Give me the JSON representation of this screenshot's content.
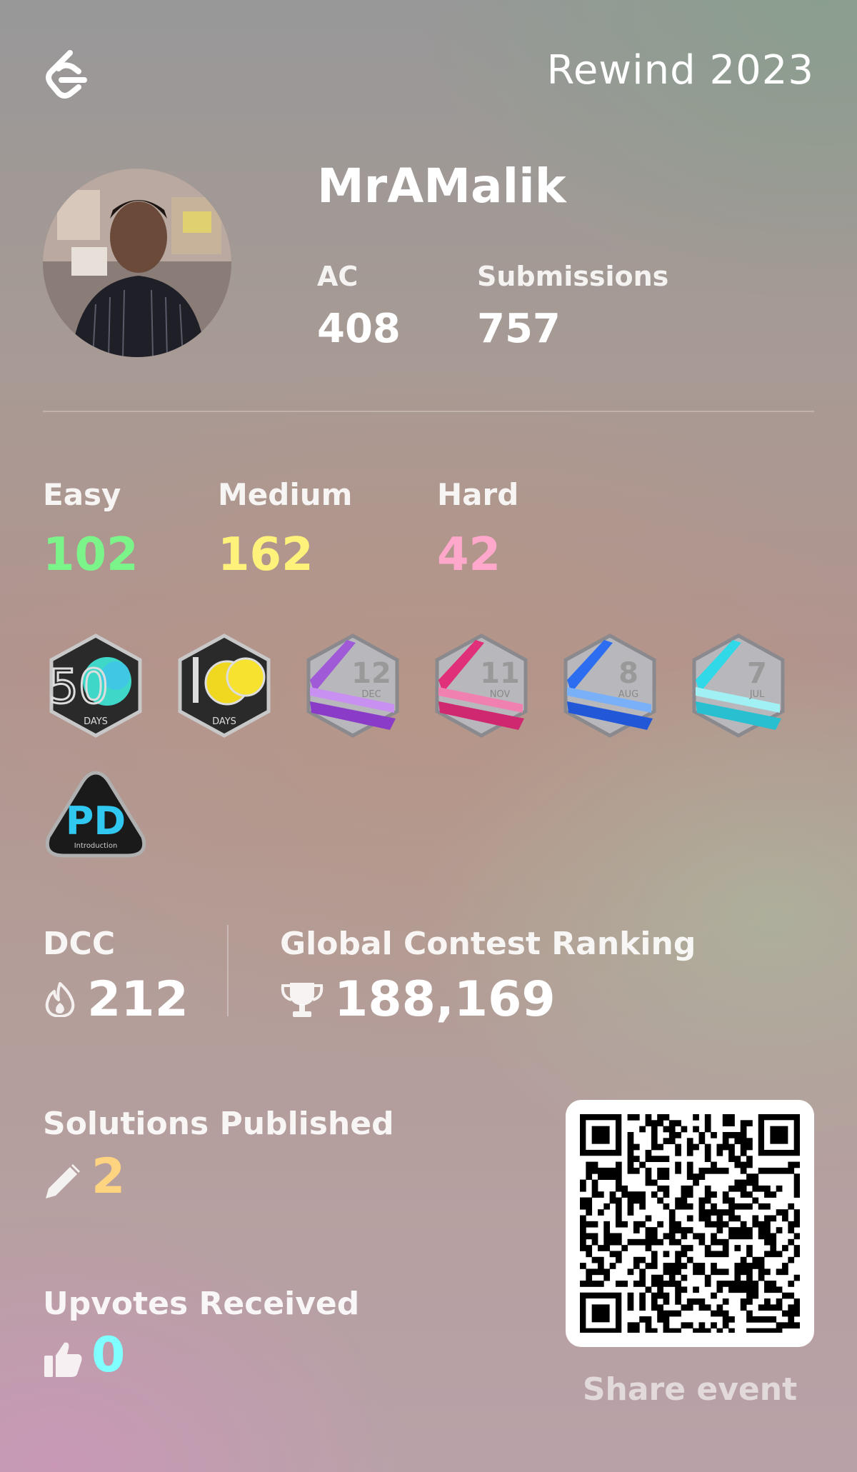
{
  "header": {
    "title": "Rewind 2023",
    "logo_icon": "leetcode-logo-icon"
  },
  "profile": {
    "username": "MrAMalik",
    "ac_label": "AC",
    "ac_value": "408",
    "submissions_label": "Submissions",
    "submissions_value": "757"
  },
  "difficulty": {
    "easy_label": "Easy",
    "easy_value": "102",
    "easy_color": "#7bf58a",
    "medium_label": "Medium",
    "medium_value": "162",
    "medium_color": "#fff27a",
    "hard_label": "Hard",
    "hard_value": "42",
    "hard_color": "#ffa8cc"
  },
  "badges": [
    {
      "name": "50 Days badge",
      "number": "50",
      "caption": "DAYS"
    },
    {
      "name": "100 Days badge",
      "number": "100",
      "caption": "DAYS"
    },
    {
      "name": "December badge",
      "number": "12",
      "caption": "DEC"
    },
    {
      "name": "November badge",
      "number": "11",
      "caption": "NOV"
    },
    {
      "name": "August badge",
      "number": "8",
      "caption": "AUG"
    },
    {
      "name": "July badge",
      "number": "7",
      "caption": "JUL"
    },
    {
      "name": "Pandas Introduction badge",
      "number": "PD",
      "caption": "Introduction"
    }
  ],
  "dcc": {
    "label": "DCC",
    "value": "212",
    "icon": "flame-icon"
  },
  "contest": {
    "label": "Global Contest Ranking",
    "value": "188,169",
    "icon": "trophy-icon"
  },
  "solutions": {
    "label": "Solutions Published",
    "value": "2",
    "icon": "pencil-icon",
    "color": "#ffd480"
  },
  "upvotes": {
    "label": "Upvotes Received",
    "value": "0",
    "icon": "thumbs-up-icon",
    "color": "#7fffff"
  },
  "share": {
    "label": "Share event"
  }
}
